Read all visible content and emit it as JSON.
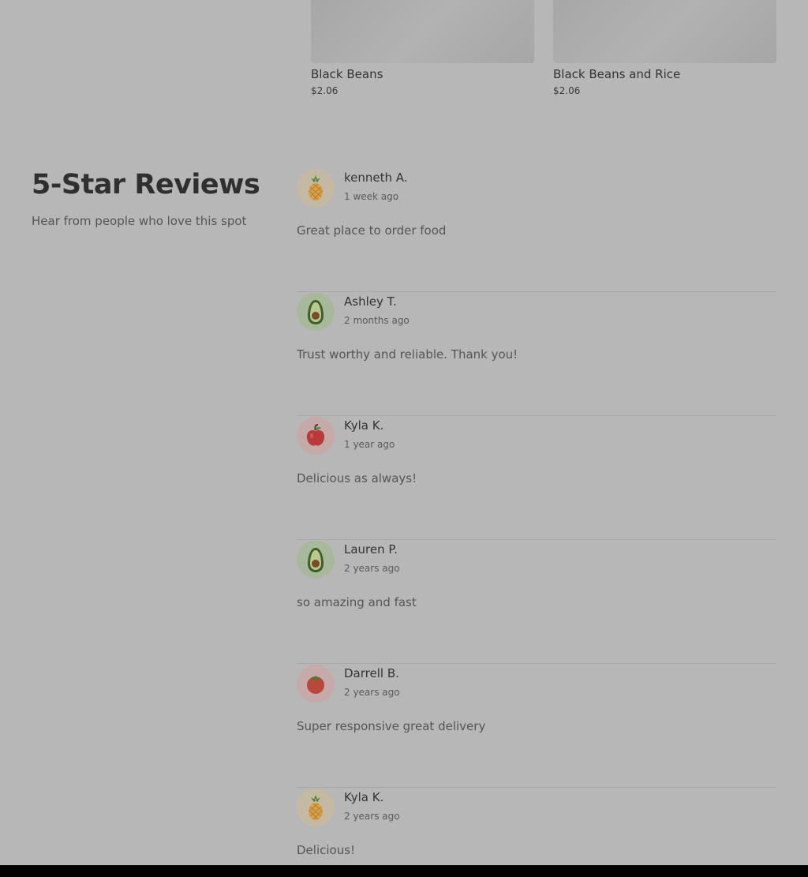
{
  "products": [
    {
      "name": "Black Beans",
      "price": "$2.06"
    },
    {
      "name": "Black Beans and Rice",
      "price": "$2.06"
    }
  ],
  "reviews_section": {
    "title": "5-Star Reviews",
    "subtitle": "Hear from people who love this spot"
  },
  "reviews": [
    {
      "name": "kenneth A.",
      "time": "1 week ago",
      "text": "Great place to order food",
      "avatar": "pineapple-icon"
    },
    {
      "name": "Ashley T.",
      "time": "2 months ago",
      "text": "Trust worthy and reliable. Thank you!",
      "avatar": "avocado-icon"
    },
    {
      "name": "Kyla K.",
      "time": "1 year ago",
      "text": "Delicious as always!",
      "avatar": "apple-icon"
    },
    {
      "name": "Lauren P.",
      "time": "2 years ago",
      "text": "so amazing and fast",
      "avatar": "avocado-icon"
    },
    {
      "name": "Darrell B.",
      "time": "2 years ago",
      "text": "Super responsive great delivery",
      "avatar": "tomato-icon"
    },
    {
      "name": "Kyla K.",
      "time": "2 years ago",
      "text": "Delicious!",
      "avatar": "pineapple-icon"
    }
  ],
  "colors": {
    "overlay_bg": "#b7b7b7",
    "divider": "#a9a9a9",
    "bottom_bar": "#000000"
  }
}
